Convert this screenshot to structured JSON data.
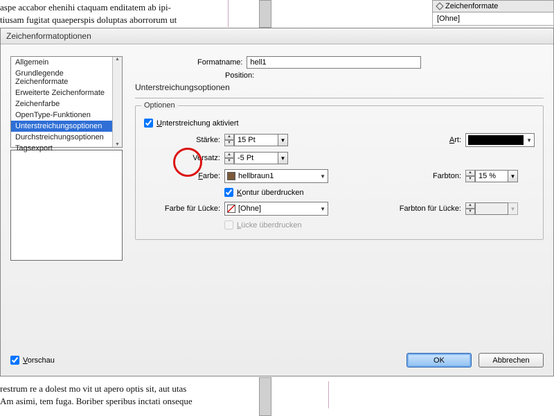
{
  "bg": {
    "top_lines": "aspe accabor ehenihi ctaquam enditatem ab ipi-\ntiusam fugitat quaeperspis doluptas aborrorum ut",
    "bottom_lines": "restrum re a dolest mo vit ut apero optis sit, aut utas\nAm asimi, tem fuga. Boriber speribus inctati onseque"
  },
  "panel": {
    "title": "Zeichenformate",
    "none": "[Ohne]"
  },
  "dialog": {
    "title": "Zeichenformatoptionen",
    "categories": [
      "Allgemein",
      "Grundlegende Zeichenformate",
      "Erweiterte Zeichenformate",
      "Zeichenfarbe",
      "OpenType-Funktionen",
      "Unterstreichungsoptionen",
      "Durchstreichungsoptionen",
      "Tagsexport"
    ],
    "selected_index": 5,
    "formatname_label": "Formatname:",
    "formatname_value": "hell1",
    "position_label": "Position:",
    "section_title": "Unterstreichungsoptionen",
    "fieldset_legend": "Optionen",
    "activate_label": "nterstreichung aktiviert",
    "activate_key": "U",
    "activate_checked": true,
    "staerke_label": "Stärke:",
    "staerke_value": "15 Pt",
    "art_label": "rt:",
    "art_key": "A",
    "versatz_label": "Versatz:",
    "versatz_value": "-5 Pt",
    "farbe_label": "arbe:",
    "farbe_key": "F",
    "farbe_value": "hellbraun1",
    "farbe_swatch": "#7a5a3a",
    "farbton_label": "Farbton:",
    "farbton_value": "15 %",
    "kontur_label": "ontur überdrucken",
    "kontur_key": "K",
    "kontur_checked": true,
    "luecke_farbe_label": "Farbe für Lücke:",
    "luecke_farbe_value": "[Ohne]",
    "luecke_farbton_label": "Farbton für Lücke:",
    "luecke_ueberdrucken_label": "ücke überdrucken",
    "luecke_key": "L",
    "luecke_checked": false,
    "vorschau_label": "orschau",
    "vorschau_key": "V",
    "vorschau_checked": true,
    "ok": "OK",
    "cancel": "Abbrechen"
  }
}
